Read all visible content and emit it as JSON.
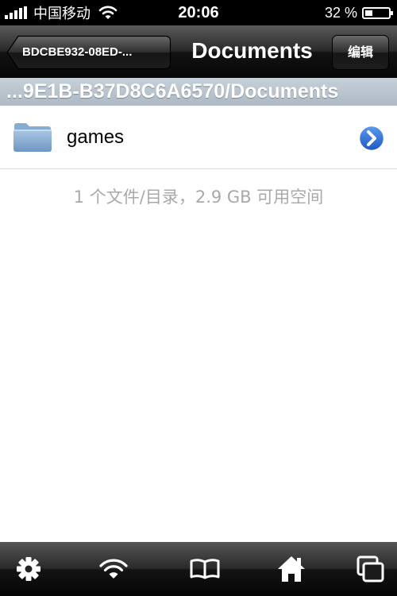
{
  "status_bar": {
    "carrier": "中国移动",
    "time": "20:06",
    "battery_percent_text": "32 %",
    "battery_level": 0.32,
    "signal_bars": 5
  },
  "nav_bar": {
    "back_label": "BDCBE932-08ED-...",
    "title": "Documents",
    "edit_label": "编辑"
  },
  "path_bar": {
    "path": "...9E1B-B37D8C6A6570/Documents"
  },
  "file_list": [
    {
      "name": "games",
      "icon": "folder-icon",
      "accessory": "detail-disclosure-icon"
    }
  ],
  "summary": "1 个文件/目录，2.9 GB 可用空间",
  "toolbar": {
    "icons": [
      "gear-icon",
      "wifi-icon",
      "book-icon",
      "home-icon",
      "windows-icon"
    ]
  },
  "colors": {
    "disclosure_blue": "#2f6fd9",
    "path_bar_gray": "#b8c3cd",
    "summary_gray": "#a9a9a9"
  }
}
